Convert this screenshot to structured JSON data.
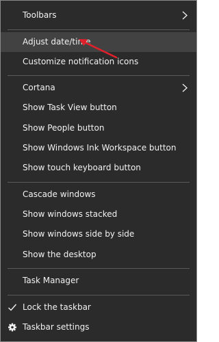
{
  "menu": {
    "items": {
      "toolbars": "Toolbars",
      "adjust_datetime": "Adjust date/time",
      "customize_notification": "Customize notification icons",
      "cortana": "Cortana",
      "show_task_view": "Show Task View button",
      "show_people": "Show People button",
      "show_ink_workspace": "Show Windows Ink Workspace button",
      "show_touch_keyboard": "Show touch keyboard button",
      "cascade": "Cascade windows",
      "stacked": "Show windows stacked",
      "side_by_side": "Show windows side by side",
      "show_desktop": "Show the desktop",
      "task_manager": "Task Manager",
      "lock_taskbar": "Lock the taskbar",
      "taskbar_settings": "Taskbar settings"
    },
    "icons": {
      "toolbars_submenu": "chevron-right-icon",
      "cortana_submenu": "chevron-right-icon",
      "lock_check": "checkmark-icon",
      "settings": "gear-icon"
    },
    "colors": {
      "background": "#2b2b2b",
      "hover": "#424242",
      "text": "#f2f2f2",
      "annotation_arrow": "#e0202a"
    }
  }
}
